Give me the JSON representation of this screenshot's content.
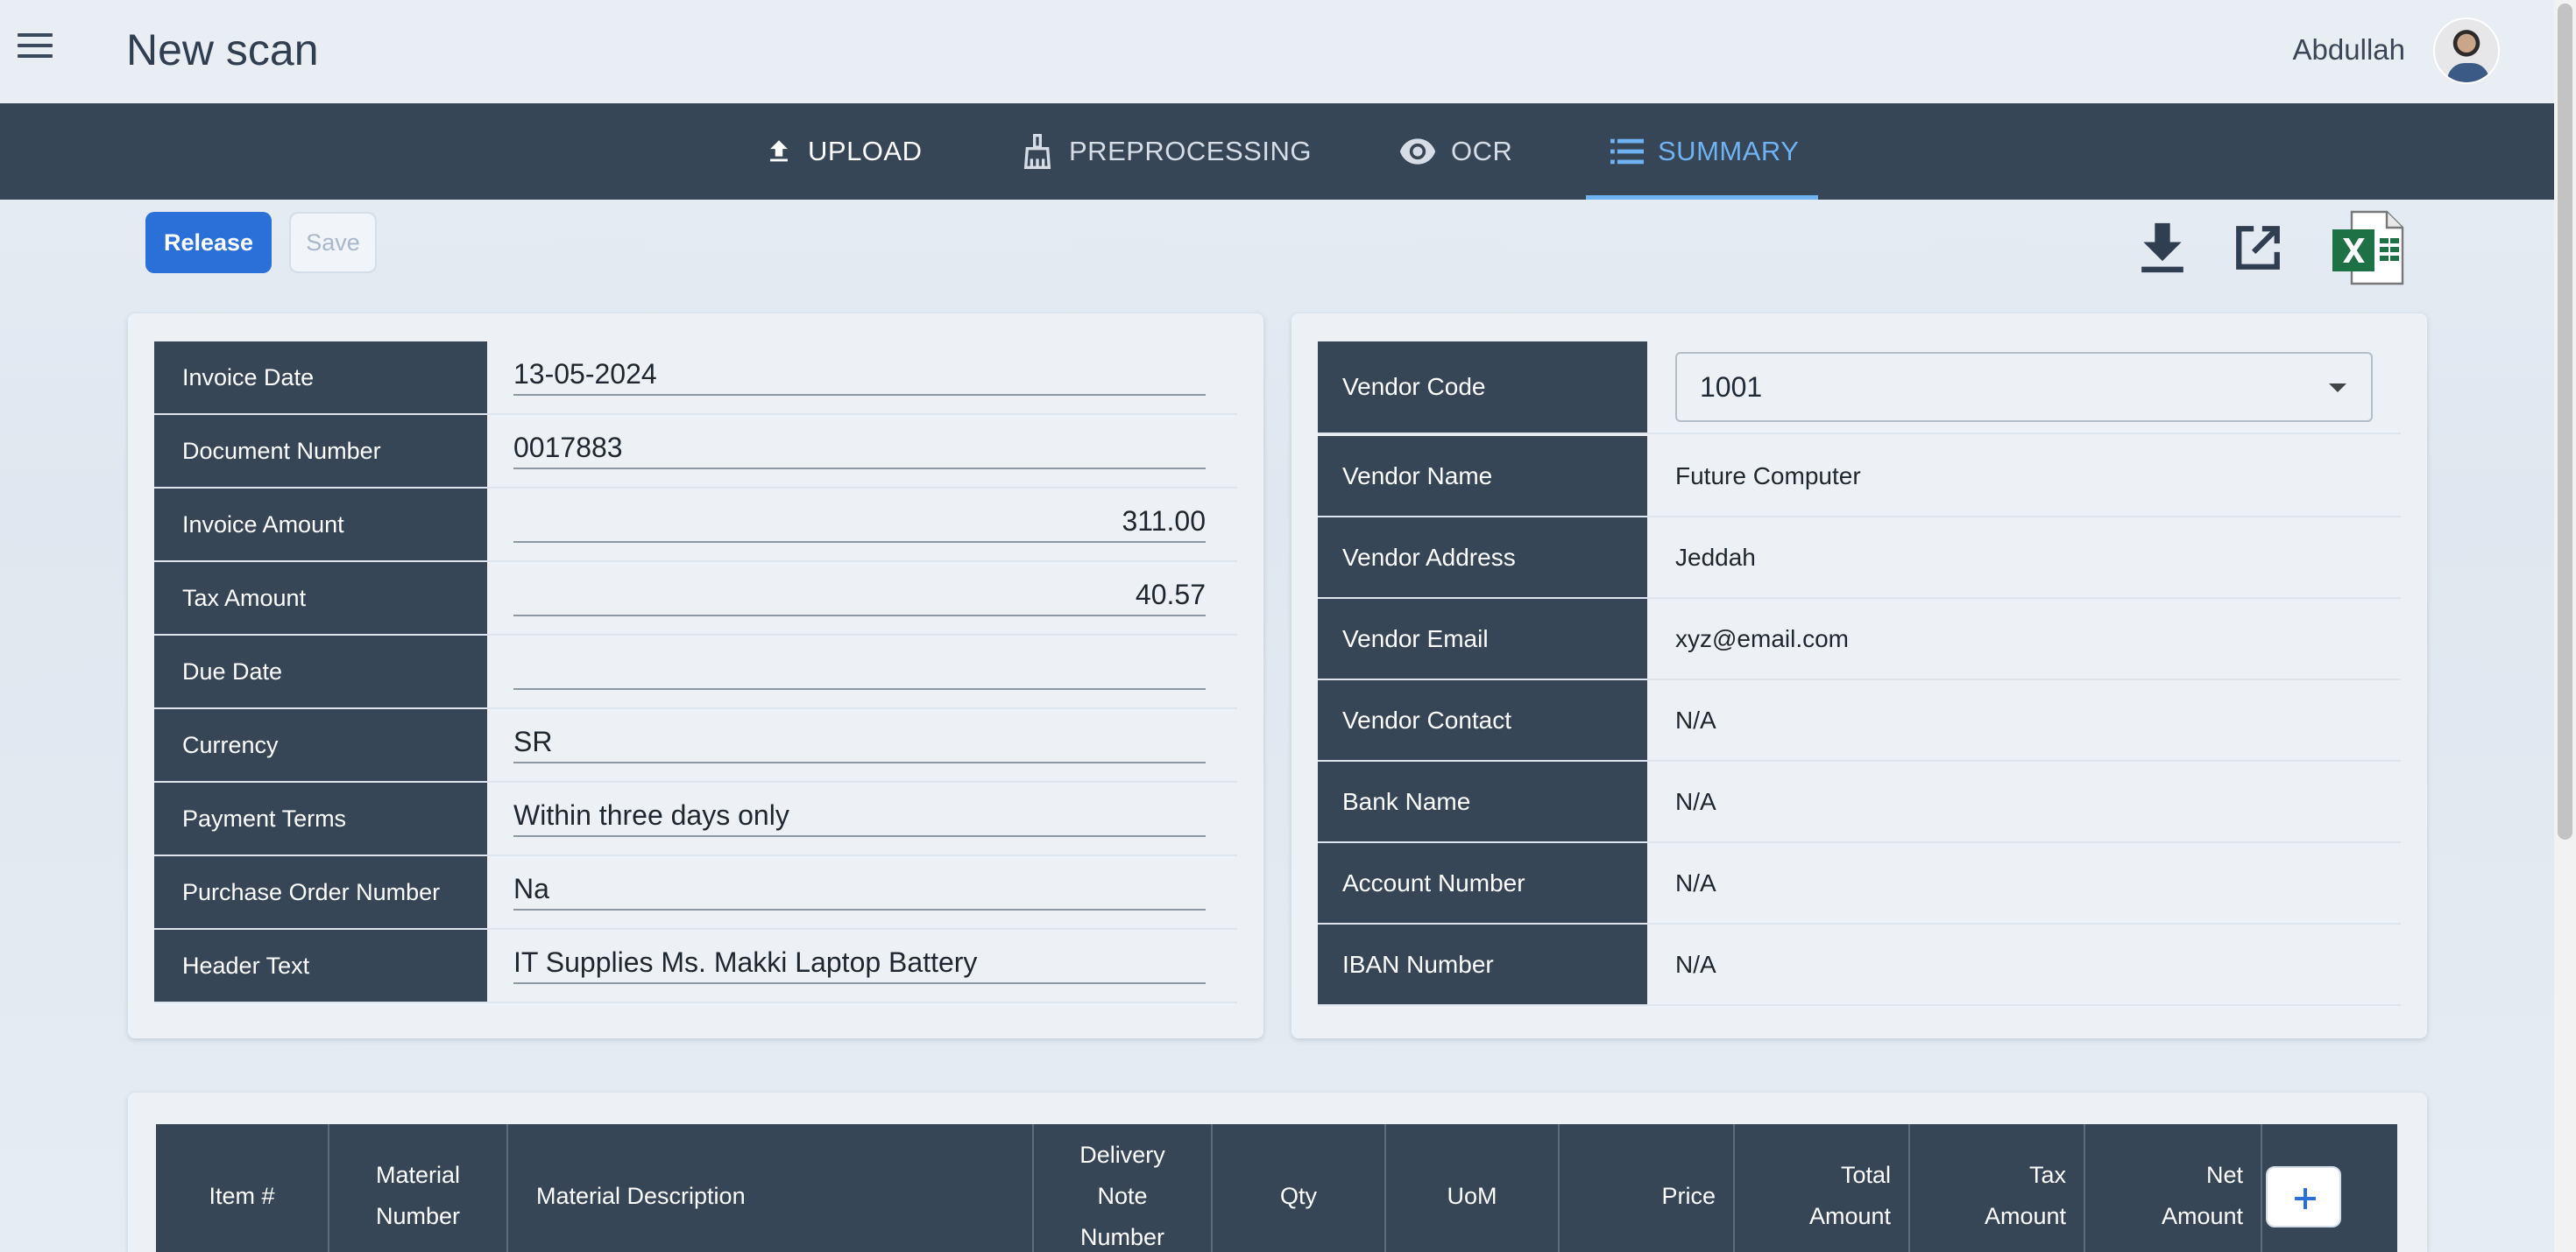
{
  "header": {
    "title": "New scan",
    "user": "Abdullah"
  },
  "tabs": [
    {
      "label": "UPLOAD",
      "icon": "upload-icon"
    },
    {
      "label": "PREPROCESSING",
      "icon": "brush-icon"
    },
    {
      "label": "OCR",
      "icon": "eye-icon"
    },
    {
      "label": "SUMMARY",
      "icon": "list-icon",
      "active": true
    }
  ],
  "actions": {
    "release": "Release",
    "save": "Save"
  },
  "invoice_fields": [
    {
      "label": "Invoice Date",
      "value": "13-05-2024"
    },
    {
      "label": "Document Number",
      "value": "0017883"
    },
    {
      "label": "Invoice Amount",
      "value": "311.00"
    },
    {
      "label": "Tax Amount",
      "value": "40.57"
    },
    {
      "label": "Due Date",
      "value": ""
    },
    {
      "label": "Currency",
      "value": "SR"
    },
    {
      "label": "Payment Terms",
      "value": "Within three days only"
    },
    {
      "label": "Purchase Order Number",
      "value": "Na"
    },
    {
      "label": "Header Text",
      "value": "IT Supplies Ms. Makki Laptop Battery"
    }
  ],
  "vendor_fields": [
    {
      "label": "Vendor Code",
      "value": "1001"
    },
    {
      "label": "Vendor Name",
      "value": "Future Computer"
    },
    {
      "label": "Vendor Address",
      "value": "Jeddah"
    },
    {
      "label": "Vendor Email",
      "value": "xyz@email.com"
    },
    {
      "label": "Vendor Contact",
      "value": "N/A"
    },
    {
      "label": "Bank Name",
      "value": "N/A"
    },
    {
      "label": "Account Number",
      "value": "N/A"
    },
    {
      "label": "IBAN Number",
      "value": "N/A"
    }
  ],
  "items_table": {
    "columns": [
      [
        "Item #"
      ],
      [
        "Material",
        "Number"
      ],
      [
        "Material Description"
      ],
      [
        "Delivery",
        "Note",
        "Number"
      ],
      [
        "Qty"
      ],
      [
        "UoM"
      ],
      [
        "Price"
      ],
      [
        "Total",
        "Amount"
      ],
      [
        "Tax",
        "Amount"
      ],
      [
        "Net",
        "Amount"
      ]
    ]
  },
  "colors": {
    "header_bg": "#364656",
    "accent": "#2b6fd8",
    "active_tab": "#6fb3f2",
    "excel_green": "#1e7145"
  }
}
